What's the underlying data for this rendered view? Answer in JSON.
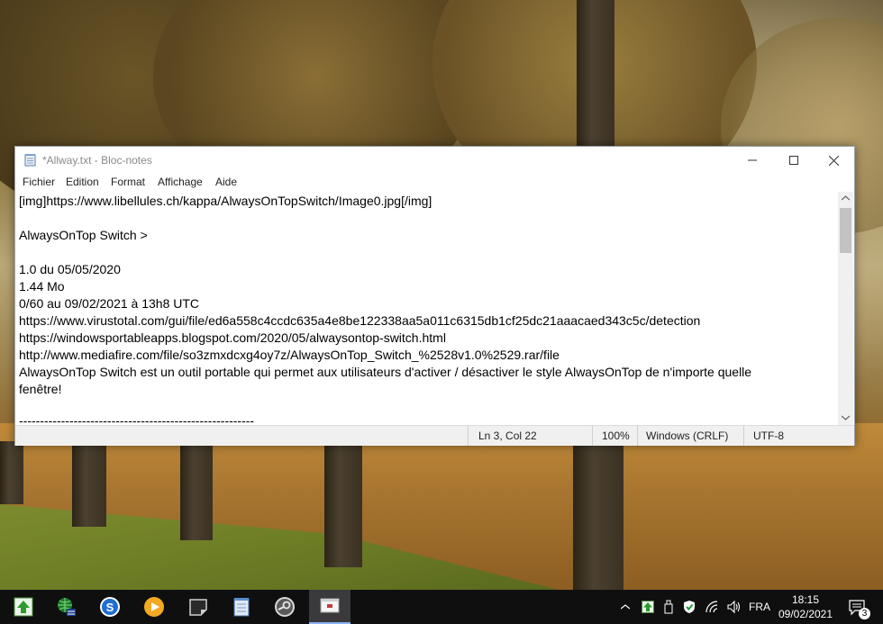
{
  "window": {
    "title": "*Allway.txt - Bloc-notes",
    "controls": {
      "minimize": "—",
      "maximize": "☐",
      "close": "✕"
    }
  },
  "menu": [
    {
      "label": "Fichier"
    },
    {
      "label": "Edition"
    },
    {
      "label": "Format"
    },
    {
      "label": "Affichage"
    },
    {
      "label": "Aide"
    }
  ],
  "document": {
    "lines": [
      "[img]https://www.libellules.ch/kappa/AlwaysOnTopSwitch/Image0.jpg[/img]",
      "",
      "AlwaysOnTop Switch >",
      "",
      "1.0 du 05/05/2020",
      "1.44 Mo",
      "0/60 au 09/02/2021 à 13h8 UTC",
      "https://www.virustotal.com/gui/file/ed6a558c4ccdc635a4e8be122338aa5a011c6315db1cf25dc21aaacaed343c5c/detection",
      "https://windowsportableapps.blogspot.com/2020/05/alwaysontop-switch.html",
      "http://www.mediafire.com/file/so3zmxdcxg4oy7z/AlwaysOnTop_Switch_%2528v1.0%2529.rar/file",
      "AlwaysOnTop Switch est un outil portable qui permet aux utilisateurs d'activer / désactiver le style AlwaysOnTop de n'importe quelle",
      "fenêtre!",
      "",
      "--------------------------------------------------------"
    ]
  },
  "statusbar": {
    "position": "Ln 3, Col 22",
    "zoom": "100%",
    "line_ending": "Windows (CRLF)",
    "encoding": "UTF-8"
  },
  "taskbar": {
    "apps": [
      {
        "icon": "green-up-arrow-icon"
      },
      {
        "icon": "network-globe-icon"
      },
      {
        "icon": "blue-s-circle-icon"
      },
      {
        "icon": "media-player-icon"
      },
      {
        "icon": "sticky-note-icon"
      },
      {
        "icon": "notepad-icon"
      },
      {
        "icon": "steam-icon"
      },
      {
        "icon": "notepad-active-icon"
      }
    ],
    "tray": {
      "language": "FRA",
      "time": "18:15",
      "date": "09/02/2021",
      "notifications_count": "3"
    }
  },
  "colors": {
    "taskbar_bg": "#0f0f10",
    "window_bg": "#ffffff",
    "statusbar_bg": "#f0f0f0"
  }
}
